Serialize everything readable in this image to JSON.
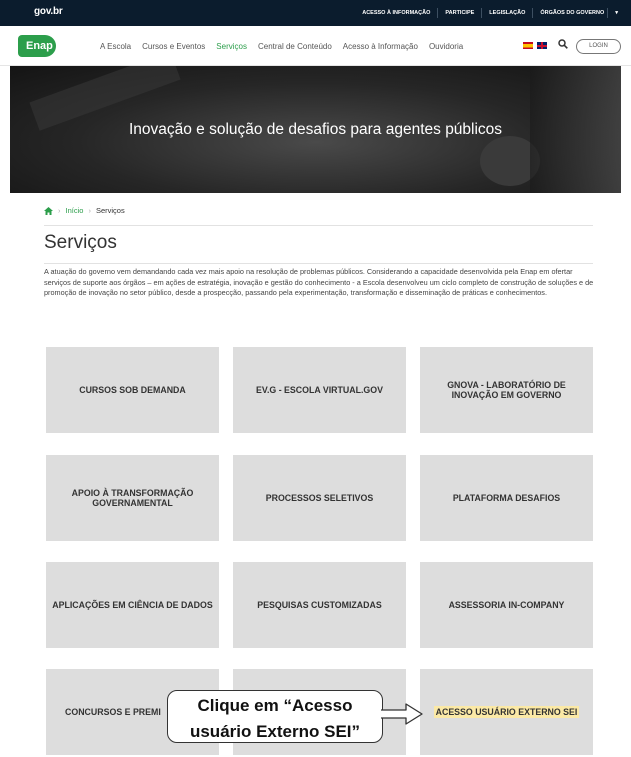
{
  "govbar": {
    "logo": "gov.br",
    "links": [
      "ACESSO À INFORMAÇÃO",
      "PARTICIPE",
      "LEGISLAÇÃO",
      "ÓRGÃOS DO GOVERNO"
    ]
  },
  "nav": {
    "logo": "Enap",
    "items": [
      "A Escola",
      "Cursos e Eventos",
      "Serviços",
      "Central de Conteúdo",
      "Acesso à Informação",
      "Ouvidoria"
    ],
    "login": "LOGIN",
    "accent": "#2c9e4b"
  },
  "hero": {
    "title": "Inovação e solução de desafios para agentes públicos"
  },
  "breadcrumb": {
    "home": "Início",
    "current": "Serviços"
  },
  "page": {
    "title": "Serviços",
    "intro": "A atuação do governo vem demandando cada vez mais apoio na resolução de problemas públicos. Considerando a capacidade desenvolvida pela Enap em ofertar serviços de suporte aos órgãos – em ações de estratégia, inovação e gestão do conhecimento - a Escola desenvolveu um ciclo completo de construção de soluções e de promoção de inovação no setor público, desde a prospecção, passando pela experimentação, transformação e disseminação de práticas e conhecimentos."
  },
  "services": [
    "CURSOS SOB DEMANDA",
    "EV.G - ESCOLA VIRTUAL.GOV",
    "GNOVA - LABORATÓRIO DE INOVAÇÃO EM GOVERNO",
    "APOIO À TRANSFORMAÇÃO GOVERNAMENTAL",
    "PROCESSOS SELETIVOS",
    "PLATAFORMA DESAFIOS",
    "APLICAÇÕES EM CIÊNCIA DE DADOS",
    "PESQUISAS CUSTOMIZADAS",
    "ASSESSORIA IN-COMPANY",
    "CONCURSOS E PREMI",
    "",
    "ACESSO USUÁRIO EXTERNO SEI"
  ],
  "callout": {
    "line1": "Clique em “Acesso",
    "line2": "usuário Externo SEI”"
  }
}
